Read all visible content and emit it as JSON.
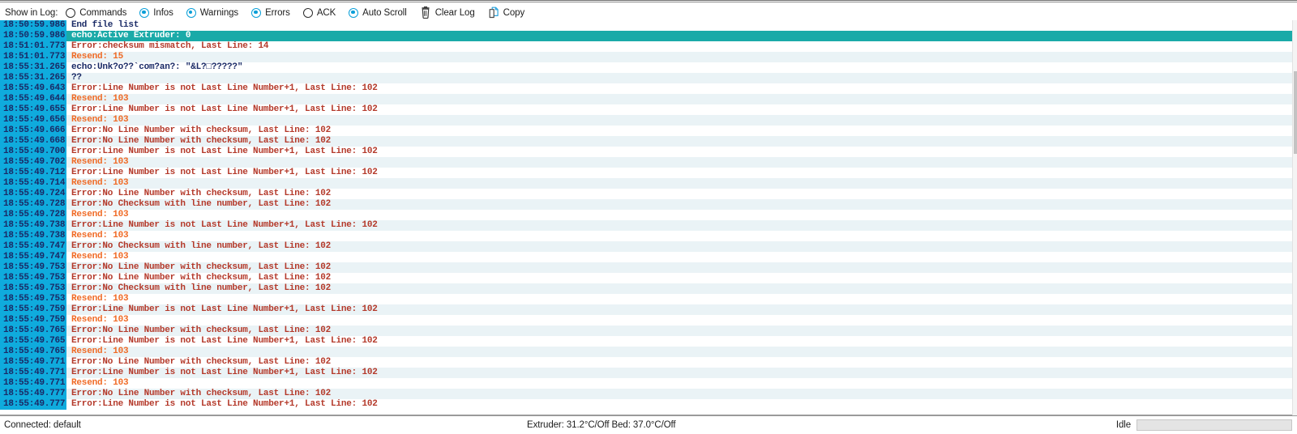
{
  "toolbar": {
    "label": "Show in Log:",
    "filters": [
      {
        "name": "commands",
        "label": "Commands",
        "checked": false
      },
      {
        "name": "infos",
        "label": "Infos",
        "checked": true
      },
      {
        "name": "warnings",
        "label": "Warnings",
        "checked": true
      },
      {
        "name": "errors",
        "label": "Errors",
        "checked": true
      },
      {
        "name": "ack",
        "label": "ACK",
        "checked": false
      },
      {
        "name": "auto-scroll",
        "label": "Auto Scroll",
        "checked": true
      }
    ],
    "clear_log_label": "Clear Log",
    "clear_log_icon": "trash-icon",
    "copy_label": "Copy",
    "copy_icon": "copy-icon"
  },
  "colors": {
    "timestamp_bg": "#0fabdd",
    "timestamp_fg": "#1a2a66",
    "row_even_bg": "#ffffff",
    "row_odd_bg": "#eaf3f6",
    "selected_bg": "#1aaaa8",
    "selected_fg": "#ffffff",
    "error_fg": "#b4392a",
    "resend_fg": "#f06a25",
    "info_fg": "#1a2a66",
    "radio_accent": "#0a9fd8",
    "progress_fill": "#06b025"
  },
  "log": {
    "rows": [
      {
        "time": "18:50:59.986",
        "text": "End file list",
        "type": "info",
        "selected": false
      },
      {
        "time": "18:50:59.986",
        "text": "echo:Active Extruder: 0",
        "type": "info",
        "selected": true
      },
      {
        "time": "18:51:01.773",
        "text": "Error:checksum mismatch, Last Line: 14",
        "type": "error",
        "selected": false
      },
      {
        "time": "18:51:01.773",
        "text": "Resend: 15",
        "type": "resend",
        "selected": false
      },
      {
        "time": "18:55:31.265",
        "text": "echo:Unk?o??`com?an?: \"&L?□?????\"",
        "type": "info",
        "selected": false
      },
      {
        "time": "18:55:31.265",
        "text": "??",
        "type": "info",
        "selected": false
      },
      {
        "time": "18:55:49.643",
        "text": "Error:Line Number is not Last Line Number+1, Last Line: 102",
        "type": "error",
        "selected": false
      },
      {
        "time": "18:55:49.644",
        "text": "Resend: 103",
        "type": "resend",
        "selected": false
      },
      {
        "time": "18:55:49.655",
        "text": "Error:Line Number is not Last Line Number+1, Last Line: 102",
        "type": "error",
        "selected": false
      },
      {
        "time": "18:55:49.656",
        "text": "Resend: 103",
        "type": "resend",
        "selected": false
      },
      {
        "time": "18:55:49.666",
        "text": "Error:No Line Number with checksum, Last Line: 102",
        "type": "error",
        "selected": false
      },
      {
        "time": "18:55:49.668",
        "text": "Error:No Line Number with checksum, Last Line: 102",
        "type": "error",
        "selected": false
      },
      {
        "time": "18:55:49.700",
        "text": "Error:Line Number is not Last Line Number+1, Last Line: 102",
        "type": "error",
        "selected": false
      },
      {
        "time": "18:55:49.702",
        "text": "Resend: 103",
        "type": "resend",
        "selected": false
      },
      {
        "time": "18:55:49.712",
        "text": "Error:Line Number is not Last Line Number+1, Last Line: 102",
        "type": "error",
        "selected": false
      },
      {
        "time": "18:55:49.714",
        "text": "Resend: 103",
        "type": "resend",
        "selected": false
      },
      {
        "time": "18:55:49.724",
        "text": "Error:No Line Number with checksum, Last Line: 102",
        "type": "error",
        "selected": false
      },
      {
        "time": "18:55:49.728",
        "text": "Error:No Checksum with line number, Last Line: 102",
        "type": "error",
        "selected": false
      },
      {
        "time": "18:55:49.728",
        "text": "Resend: 103",
        "type": "resend",
        "selected": false
      },
      {
        "time": "18:55:49.738",
        "text": "Error:Line Number is not Last Line Number+1, Last Line: 102",
        "type": "error",
        "selected": false
      },
      {
        "time": "18:55:49.738",
        "text": "Resend: 103",
        "type": "resend",
        "selected": false
      },
      {
        "time": "18:55:49.747",
        "text": "Error:No Checksum with line number, Last Line: 102",
        "type": "error",
        "selected": false
      },
      {
        "time": "18:55:49.747",
        "text": "Resend: 103",
        "type": "resend",
        "selected": false
      },
      {
        "time": "18:55:49.753",
        "text": "Error:No Line Number with checksum, Last Line: 102",
        "type": "error",
        "selected": false
      },
      {
        "time": "18:55:49.753",
        "text": "Error:No Line Number with checksum, Last Line: 102",
        "type": "error",
        "selected": false
      },
      {
        "time": "18:55:49.753",
        "text": "Error:No Checksum with line number, Last Line: 102",
        "type": "error",
        "selected": false
      },
      {
        "time": "18:55:49.753",
        "text": "Resend: 103",
        "type": "resend",
        "selected": false
      },
      {
        "time": "18:55:49.759",
        "text": "Error:Line Number is not Last Line Number+1, Last Line: 102",
        "type": "error",
        "selected": false
      },
      {
        "time": "18:55:49.759",
        "text": "Resend: 103",
        "type": "resend",
        "selected": false
      },
      {
        "time": "18:55:49.765",
        "text": "Error:No Line Number with checksum, Last Line: 102",
        "type": "error",
        "selected": false
      },
      {
        "time": "18:55:49.765",
        "text": "Error:Line Number is not Last Line Number+1, Last Line: 102",
        "type": "error",
        "selected": false
      },
      {
        "time": "18:55:49.765",
        "text": "Resend: 103",
        "type": "resend",
        "selected": false
      },
      {
        "time": "18:55:49.771",
        "text": "Error:No Line Number with checksum, Last Line: 102",
        "type": "error",
        "selected": false
      },
      {
        "time": "18:55:49.771",
        "text": "Error:Line Number is not Last Line Number+1, Last Line: 102",
        "type": "error",
        "selected": false
      },
      {
        "time": "18:55:49.771",
        "text": "Resend: 103",
        "type": "resend",
        "selected": false
      },
      {
        "time": "18:55:49.777",
        "text": "Error:No Line Number with checksum, Last Line: 102",
        "type": "error",
        "selected": false
      },
      {
        "time": "18:55:49.777",
        "text": "Error:Line Number is not Last Line Number+1, Last Line: 102",
        "type": "error",
        "selected": false
      }
    ]
  },
  "statusbar": {
    "connection": "Connected: default",
    "temperatures": "Extruder: 31.2°C/Off Bed: 37.0°C/Off",
    "job_state": "Idle",
    "progress_percent": 0
  }
}
